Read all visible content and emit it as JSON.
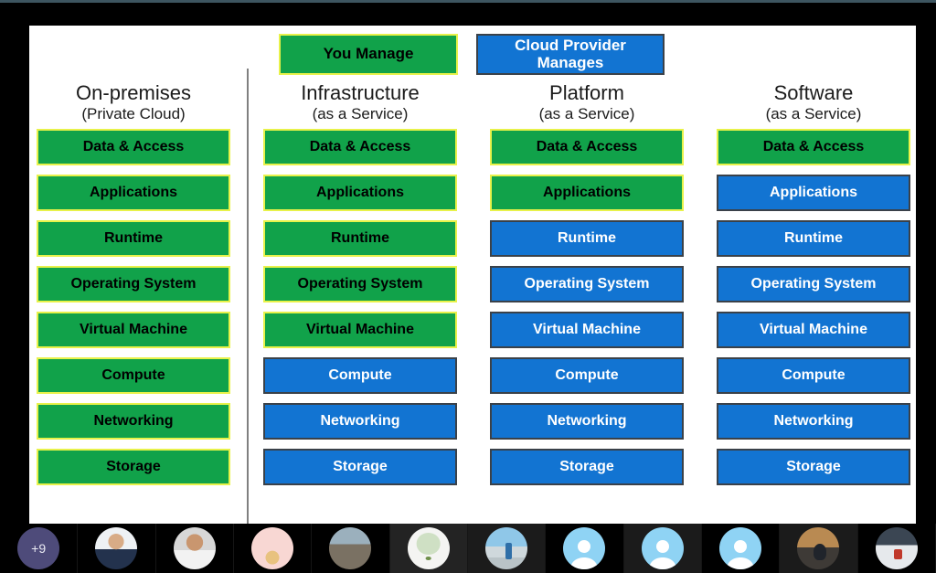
{
  "slide": {
    "legend": {
      "customer_label": "You Manage",
      "provider_label": "Cloud Provider Manages",
      "customer_color": "#11a24a",
      "customer_border_color": "#e8f24a",
      "provider_color": "#1274d2",
      "provider_border_color": "#3a4149"
    },
    "columns": [
      {
        "title": "On-premises",
        "subtitle": "(Private Cloud)",
        "layers": [
          {
            "label": "Data & Access",
            "owner": "customer"
          },
          {
            "label": "Applications",
            "owner": "customer"
          },
          {
            "label": "Runtime",
            "owner": "customer"
          },
          {
            "label": "Operating System",
            "owner": "customer"
          },
          {
            "label": "Virtual Machine",
            "owner": "customer"
          },
          {
            "label": "Compute",
            "owner": "customer"
          },
          {
            "label": "Networking",
            "owner": "customer"
          },
          {
            "label": "Storage",
            "owner": "customer"
          }
        ]
      },
      {
        "title": "Infrastructure",
        "subtitle": "(as a Service)",
        "layers": [
          {
            "label": "Data & Access",
            "owner": "customer"
          },
          {
            "label": "Applications",
            "owner": "customer"
          },
          {
            "label": "Runtime",
            "owner": "customer"
          },
          {
            "label": "Operating System",
            "owner": "customer"
          },
          {
            "label": "Virtual Machine",
            "owner": "customer"
          },
          {
            "label": "Compute",
            "owner": "provider"
          },
          {
            "label": "Networking",
            "owner": "provider"
          },
          {
            "label": "Storage",
            "owner": "provider"
          }
        ]
      },
      {
        "title": "Platform",
        "subtitle": "(as a Service)",
        "layers": [
          {
            "label": "Data & Access",
            "owner": "customer"
          },
          {
            "label": "Applications",
            "owner": "customer"
          },
          {
            "label": "Runtime",
            "owner": "provider"
          },
          {
            "label": "Operating System",
            "owner": "provider"
          },
          {
            "label": "Virtual Machine",
            "owner": "provider"
          },
          {
            "label": "Compute",
            "owner": "provider"
          },
          {
            "label": "Networking",
            "owner": "provider"
          },
          {
            "label": "Storage",
            "owner": "provider"
          }
        ]
      },
      {
        "title": "Software",
        "subtitle": "(as a Service)",
        "layers": [
          {
            "label": "Data & Access",
            "owner": "customer"
          },
          {
            "label": "Applications",
            "owner": "provider"
          },
          {
            "label": "Runtime",
            "owner": "provider"
          },
          {
            "label": "Operating System",
            "owner": "provider"
          },
          {
            "label": "Virtual Machine",
            "owner": "provider"
          },
          {
            "label": "Compute",
            "owner": "provider"
          },
          {
            "label": "Networking",
            "owner": "provider"
          },
          {
            "label": "Storage",
            "owner": "provider"
          }
        ]
      }
    ]
  },
  "participants": [
    {
      "kind": "overflow",
      "label": "+9",
      "tile": "dark"
    },
    {
      "kind": "photo",
      "photo": "ph-suit",
      "tile": "dark"
    },
    {
      "kind": "photo",
      "photo": "ph-white",
      "tile": "dark"
    },
    {
      "kind": "photo",
      "photo": "ph-pink",
      "tile": "dark"
    },
    {
      "kind": "photo",
      "photo": "ph-outdoor",
      "tile": "dark"
    },
    {
      "kind": "photo",
      "photo": "ph-tree",
      "tile": "grey"
    },
    {
      "kind": "photo",
      "photo": "ph-beach",
      "tile": "grey2"
    },
    {
      "kind": "default",
      "icon": "person-icon",
      "tile": "dark"
    },
    {
      "kind": "default",
      "icon": "person-icon",
      "tile": "grey2"
    },
    {
      "kind": "default",
      "icon": "person-icon",
      "tile": "dark"
    },
    {
      "kind": "photo",
      "photo": "ph-desk",
      "tile": "grey2"
    },
    {
      "kind": "photo",
      "photo": "ph-phone",
      "tile": "dark"
    }
  ]
}
